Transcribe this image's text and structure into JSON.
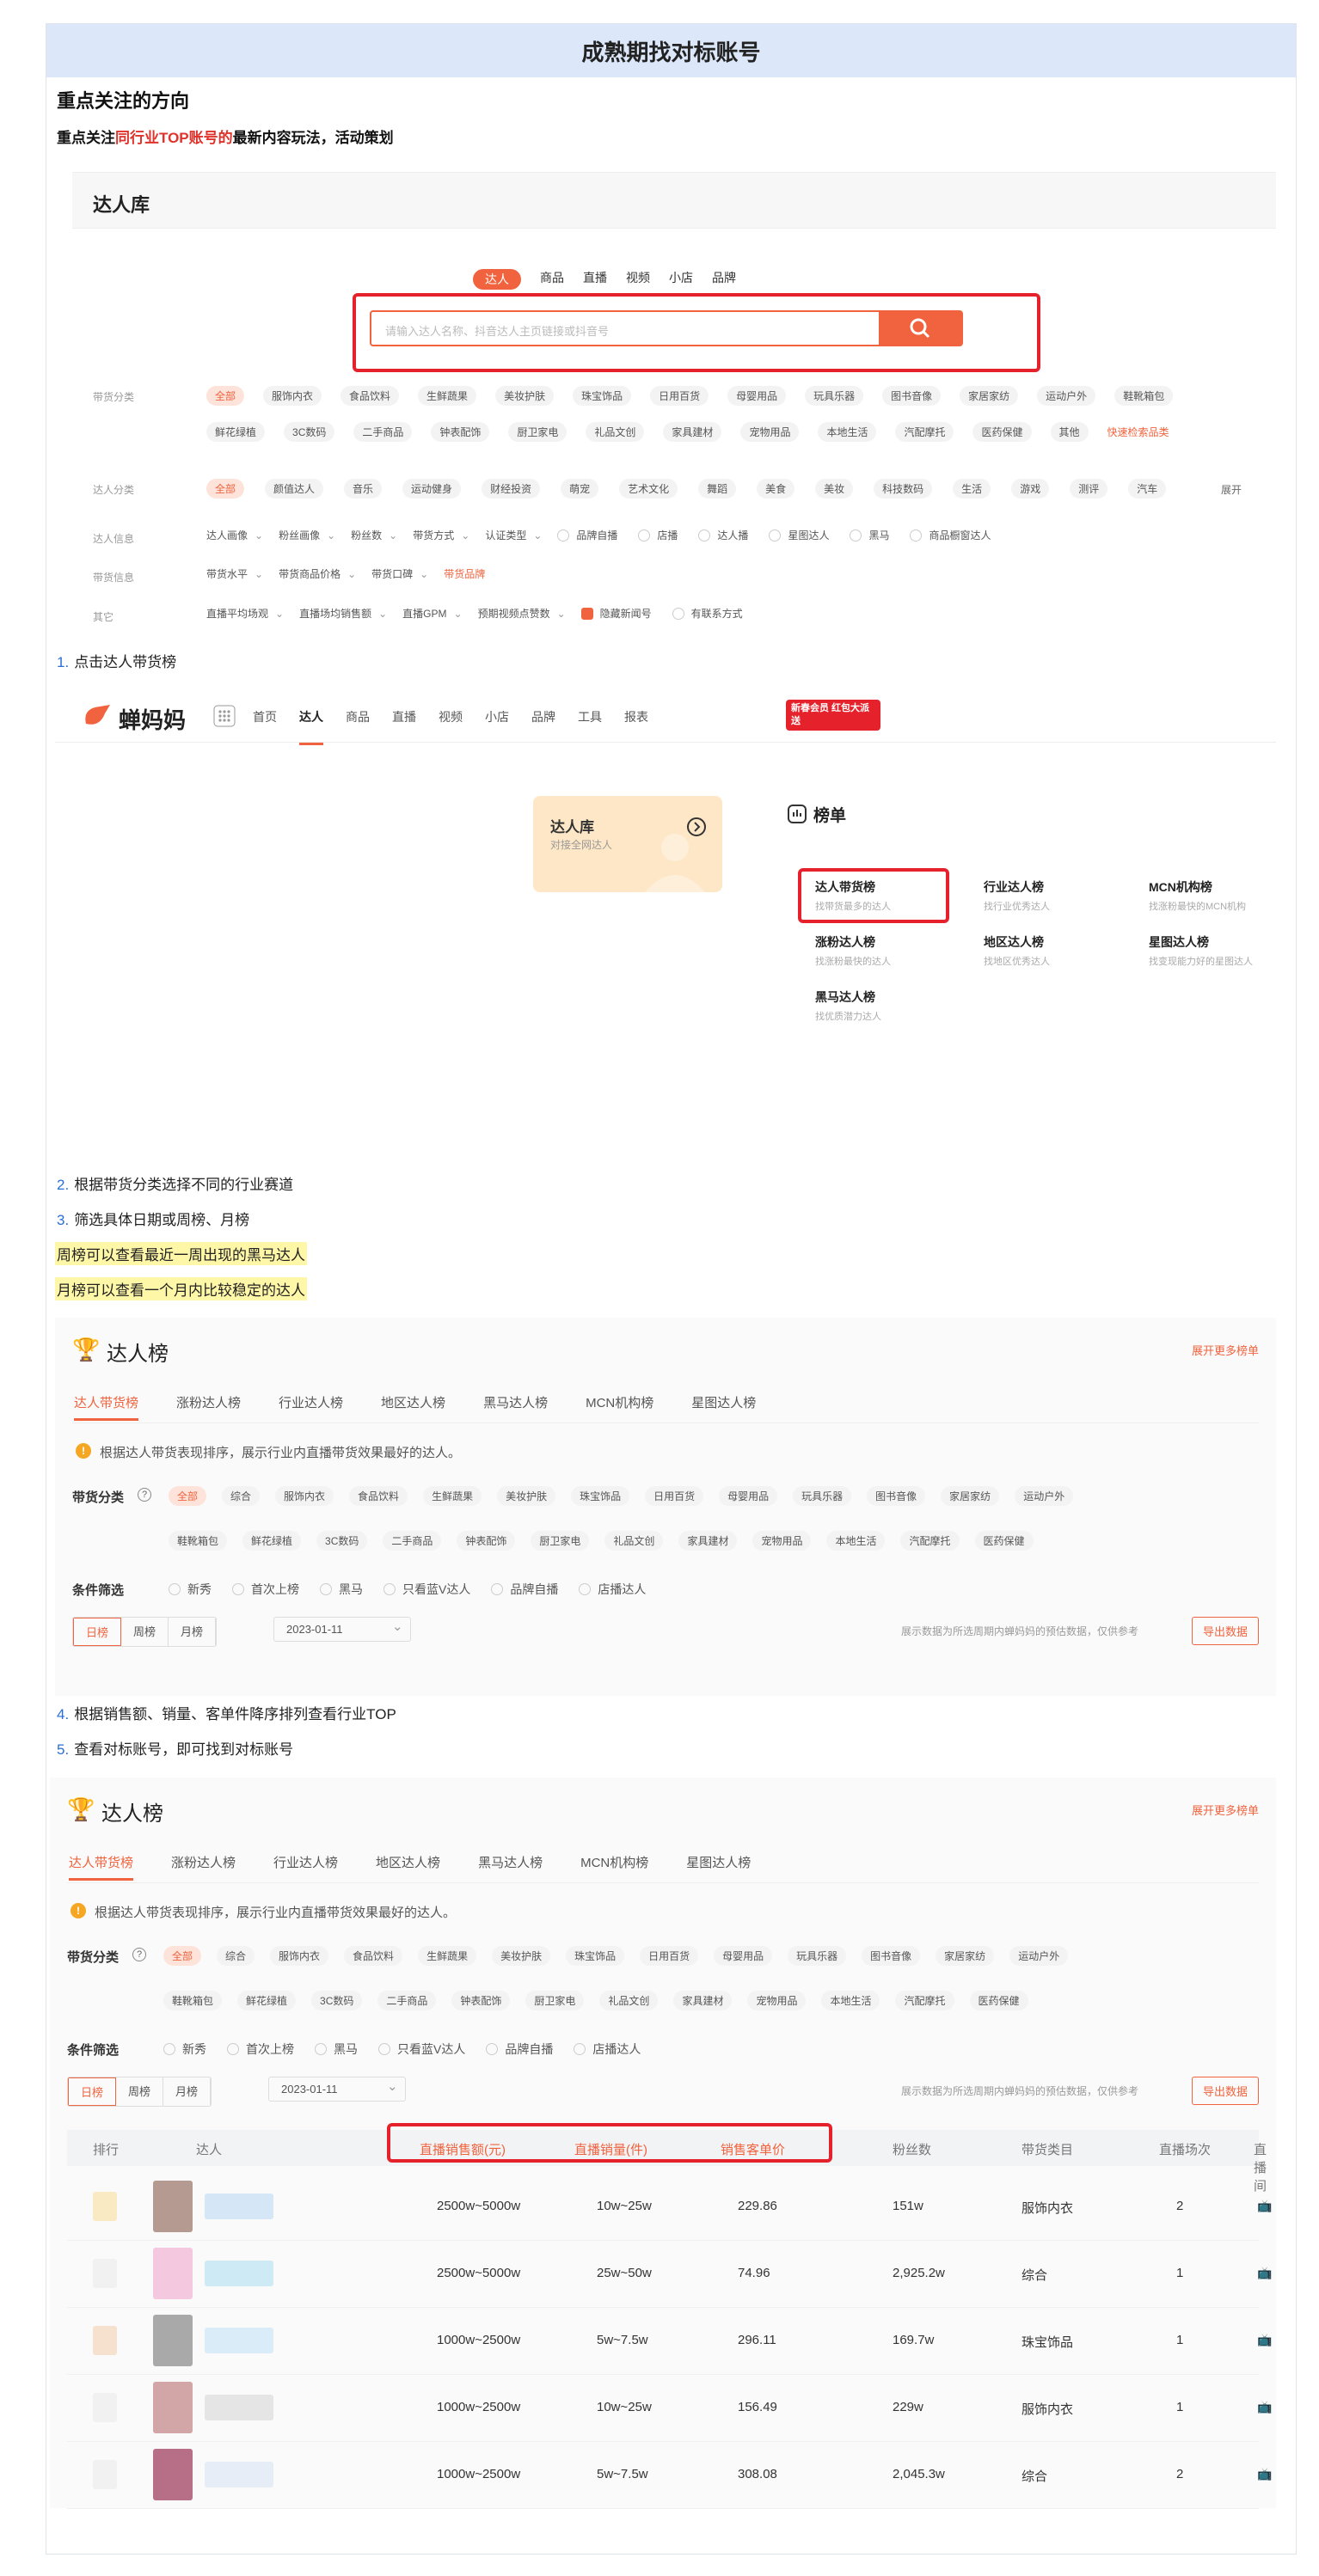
{
  "header": {
    "title": "成熟期找对标账号"
  },
  "intro": {
    "heading": "重点关注的方向",
    "sub_prefix": "重点关注",
    "sub_red": "同行业TOP账号的",
    "sub_suffix": "最新内容玩法，活动策划"
  },
  "lib": {
    "title": "达人库",
    "tabs": [
      "达人",
      "商品",
      "直播",
      "视频",
      "小店",
      "品牌"
    ],
    "search_placeholder": "请输入达人名称、抖音达人主页链接或抖音号",
    "row_labels": [
      "带货分类",
      "达人分类",
      "达人信息",
      "带货信息",
      "其它"
    ],
    "cat1": [
      "全部",
      "服饰内衣",
      "食品饮料",
      "生鲜蔬果",
      "美妆护肤",
      "珠宝饰品",
      "日用百货",
      "母婴用品",
      "玩具乐器",
      "图书音像",
      "家居家纺",
      "运动户外",
      "鞋靴箱包"
    ],
    "cat1b": [
      "鲜花绿植",
      "3C数码",
      "二手商品",
      "钟表配饰",
      "厨卫家电",
      "礼品文创",
      "家具建材",
      "宠物用品",
      "本地生活",
      "汽配摩托",
      "医药保健",
      "其他"
    ],
    "cat1b_link": "快速检索品类",
    "cat2": [
      "全部",
      "颜值达人",
      "音乐",
      "运动健身",
      "财经投资",
      "萌宠",
      "艺术文化",
      "舞蹈",
      "美食",
      "美妆",
      "科技数码",
      "生活",
      "游戏",
      "测评",
      "汽车"
    ],
    "cat2_more": "展开",
    "info": [
      "达人画像",
      "粉丝画像",
      "粉丝数",
      "带货方式",
      "认证类型"
    ],
    "info_chk": [
      "品牌自播",
      "店播",
      "达人播",
      "星图达人",
      "黑马",
      "商品橱窗达人"
    ],
    "goods": [
      "带货水平",
      "带货商品价格",
      "带货口碑"
    ],
    "goods_link": "带货品牌",
    "other": [
      "直播平均场观",
      "直播场均销售额",
      "直播GPM",
      "预期视频点赞数"
    ],
    "other_chk": [
      "隐藏新闻号",
      "有联系方式"
    ]
  },
  "steps": {
    "s1": "点击达人带货榜",
    "s2": "根据带货分类选择不同的行业赛道",
    "s3": "筛选具体日期或周榜、月榜",
    "s4": "根据销售额、销量、客单件降序排列查看行业TOP",
    "s5": "查看对标账号，即可找到对标账号",
    "n1": "1.",
    "n2": "2.",
    "n3": "3.",
    "n4": "4.",
    "n5": "5."
  },
  "notes": {
    "week": "周榜可以查看最近一周出现的黑马达人",
    "month": "月榜可以查看一个月内比较稳定的达人"
  },
  "nav": {
    "logo": "蝉妈妈",
    "items": [
      "首页",
      "达人",
      "商品",
      "直播",
      "视频",
      "小店",
      "品牌",
      "工具",
      "报表"
    ],
    "promo": "新春会员 红包大派送"
  },
  "menu": {
    "card_title": "达人库",
    "card_sub": "对接全网达人",
    "rank_title": "榜单",
    "items": [
      [
        "达人带货榜",
        "找带货最多的达人"
      ],
      [
        "行业达人榜",
        "找行业优秀达人"
      ],
      [
        "MCN机构榜",
        "找涨粉最快的MCN机构"
      ],
      [
        "涨粉达人榜",
        "找涨粉最快的达人"
      ],
      [
        "地区达人榜",
        "找地区优秀达人"
      ],
      [
        "星图达人榜",
        "找变现能力好的星图达人"
      ],
      [
        "黑马达人榜",
        "找优质潜力达人"
      ]
    ]
  },
  "rank": {
    "title": "达人榜",
    "more": "展开更多榜单",
    "tabs": [
      "达人带货榜",
      "涨粉达人榜",
      "行业达人榜",
      "地区达人榜",
      "黑马达人榜",
      "MCN机构榜",
      "星图达人榜"
    ],
    "notice": "根据达人带货表现排序，展示行业内直播带货效果最好的达人。",
    "notice2": "根据达人带货表现排序，展示行业内直播带货效果最好的达人。",
    "cat_label": "带货分类",
    "cats": [
      "全部",
      "综合",
      "服饰内衣",
      "食品饮料",
      "生鲜蔬果",
      "美妆护肤",
      "珠宝饰品",
      "日用百货",
      "母婴用品",
      "玩具乐器",
      "图书音像",
      "家居家纺",
      "运动户外"
    ],
    "cats2": [
      "鞋靴箱包",
      "鲜花绿植",
      "3C数码",
      "二手商品",
      "钟表配饰",
      "厨卫家电",
      "礼品文创",
      "家具建材",
      "宠物用品",
      "本地生活",
      "汽配摩托",
      "医药保健"
    ],
    "filter_label": "条件筛选",
    "filters": [
      "新秀",
      "首次上榜",
      "黑马",
      "只看蓝V达人",
      "品牌自播",
      "店播达人"
    ],
    "periods": [
      "日榜",
      "周榜",
      "月榜"
    ],
    "date": "2023-01-11",
    "disclaimer": "展示数据为所选周期内蝉妈妈的预估数据，仅供参考",
    "export": "导出数据"
  },
  "table": {
    "headers": [
      "排行",
      "达人",
      "直播销售额(元)",
      "直播销量(件)",
      "销售客单价",
      "粉丝数",
      "带货类目",
      "直播场次",
      "直播间"
    ],
    "rows": [
      [
        "2500w~5000w",
        "10w~25w",
        "229.86",
        "151w",
        "服饰内衣",
        "2"
      ],
      [
        "2500w~5000w",
        "25w~50w",
        "74.96",
        "2,925.2w",
        "综合",
        "1"
      ],
      [
        "1000w~2500w",
        "5w~7.5w",
        "296.11",
        "169.7w",
        "珠宝饰品",
        "1"
      ],
      [
        "1000w~2500w",
        "10w~25w",
        "156.49",
        "229w",
        "服饰内衣",
        "1"
      ],
      [
        "1000w~2500w",
        "5w~7.5w",
        "308.08",
        "2,045.3w",
        "综合",
        "2"
      ]
    ]
  }
}
